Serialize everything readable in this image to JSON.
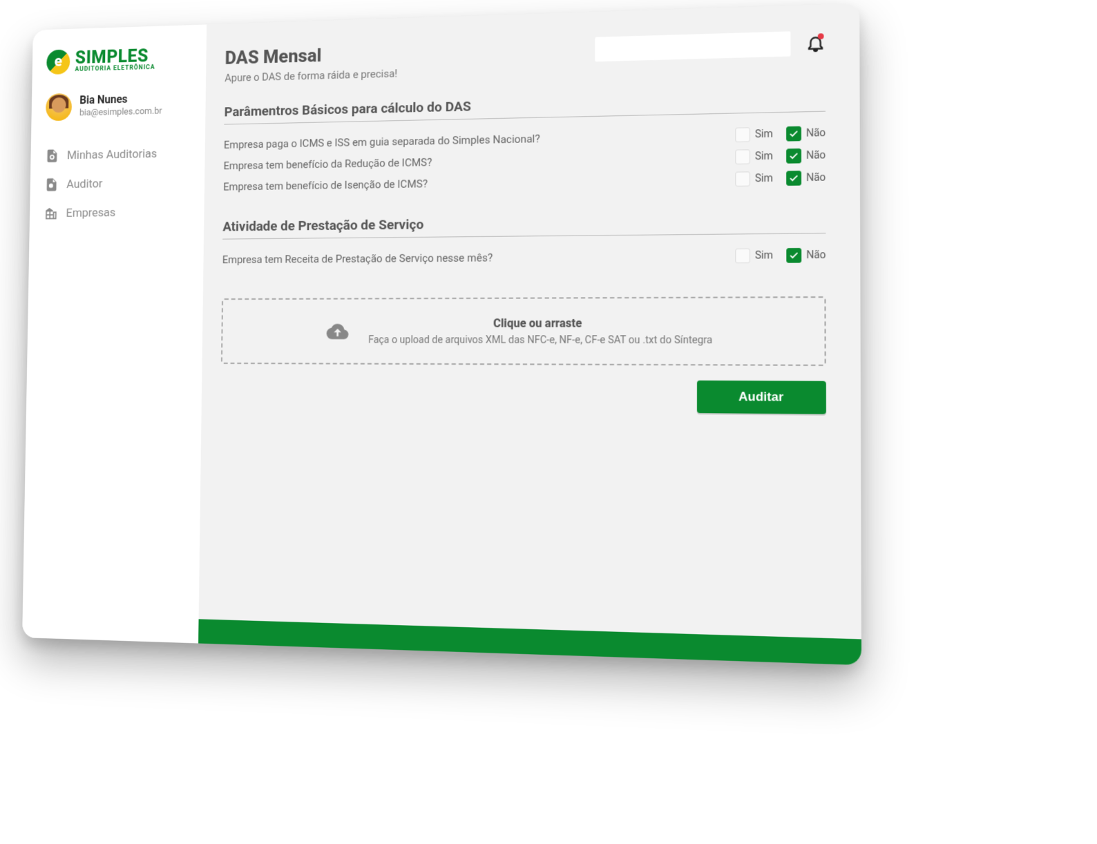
{
  "brand": {
    "name": "SIMPLES",
    "tagline": "AUDITORIA ELETRÔNICA"
  },
  "user": {
    "name": "Bia Nunes",
    "email": "bia@esimples.com.br"
  },
  "nav": {
    "auditorias": "Minhas Auditorias",
    "auditor": "Auditor",
    "empresas": "Empresas"
  },
  "page": {
    "title": "DAS Mensal",
    "subtitle": "Apure o DAS de forma ráida e precisa!"
  },
  "section1": {
    "title": "Parâmentros Básicos para cálculo do DAS",
    "q1": "Empresa paga o ICMS e ISS em guia separada do Simples Nacional?",
    "q2": "Empresa tem benefício da Redução de ICMS?",
    "q3": "Empresa tem benefício de Isenção de ICMS?"
  },
  "section2": {
    "title": "Atividade de Prestação de Serviço",
    "q1": "Empresa tem Receita de Prestação de Serviço nesse mês?"
  },
  "labels": {
    "sim": "Sim",
    "nao": "Não"
  },
  "dropzone": {
    "title": "Clique ou arraste",
    "subtitle": "Faça o upload de arquivos XML das NFC-e, NF-e, CF-e SAT ou .txt do Síntegra"
  },
  "actions": {
    "auditar": "Auditar"
  }
}
